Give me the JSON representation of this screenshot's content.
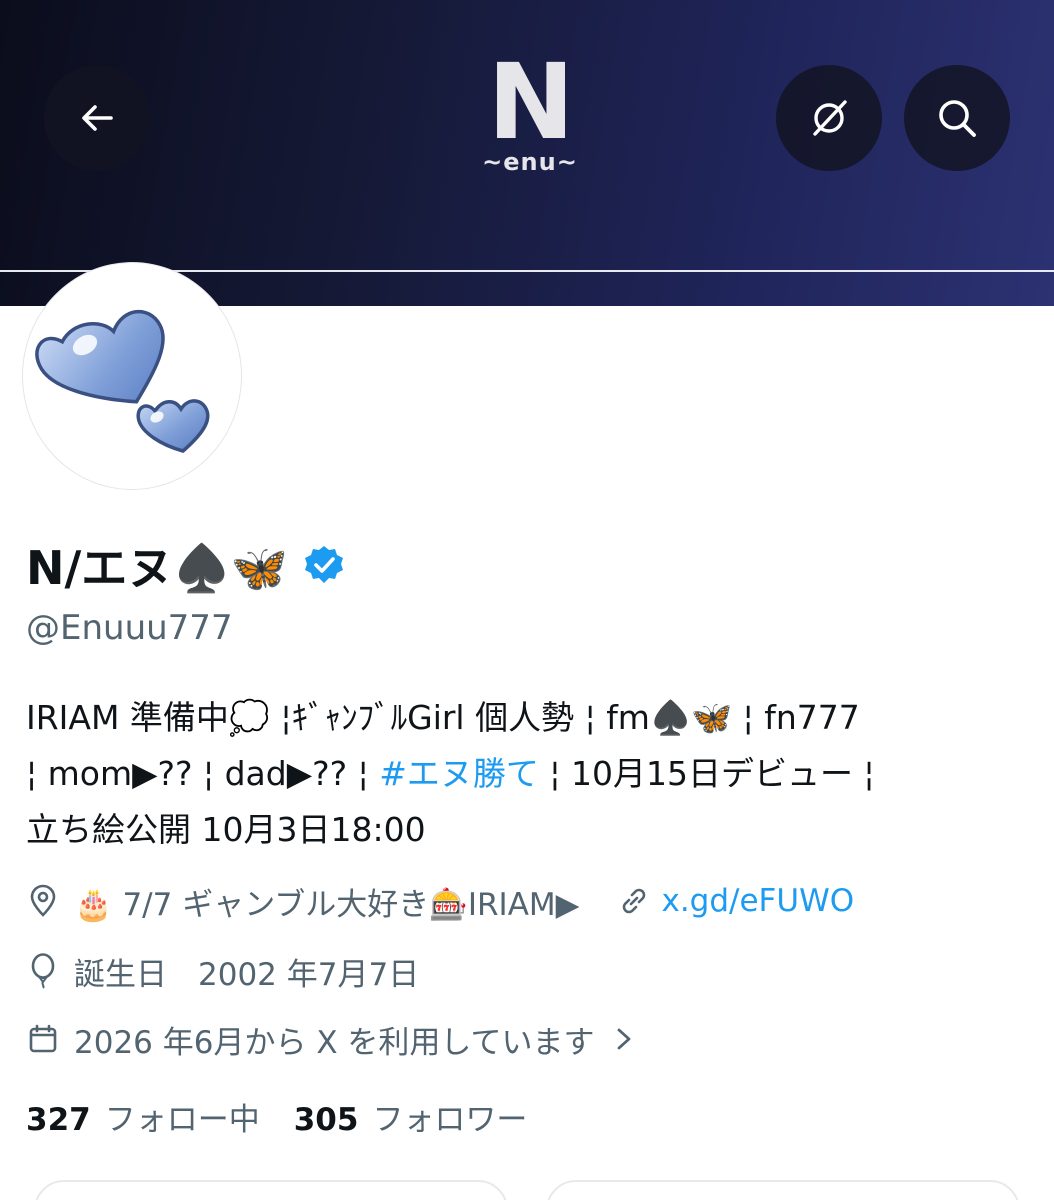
{
  "header": {
    "logo_letter": "N",
    "logo_sub": "~enu~",
    "icons": [
      "back-arrow-icon",
      "grok-icon",
      "search-icon"
    ]
  },
  "profile": {
    "display_name": "N/エヌ♠️🦋",
    "handle": "@Enuuu777",
    "verified": true
  },
  "bio": {
    "line1": "IRIAM 準備中💭 ¦ｷﾞｬﾝﾌﾞﾙGirl 個人勢 ¦ fm♠️🦋 ¦ fn777",
    "line2_pre": "¦ mom▶︎?? ¦ dad▶︎?? ¦ ",
    "hashtag": "#エヌ勝て",
    "line2_post": " ¦ 10月15日デビュー ¦",
    "line3": "立ち絵公開 10月3日18:00"
  },
  "meta": {
    "location": "🎂 7/7 ギャンブル大好き🎰IRIAM▶︎",
    "link": "x.gd/eFUWO",
    "birthday": "誕生日　2002 年7月7日",
    "joined": "2026 年6月から X を利用しています"
  },
  "stats": {
    "following_count": "327",
    "following_label": "フォロー中",
    "followers_count": "305",
    "followers_label": "フォロワー"
  },
  "colors": {
    "accent": "#1d9bf0",
    "secondary_text": "#536471",
    "primary_text": "#0f1419"
  }
}
